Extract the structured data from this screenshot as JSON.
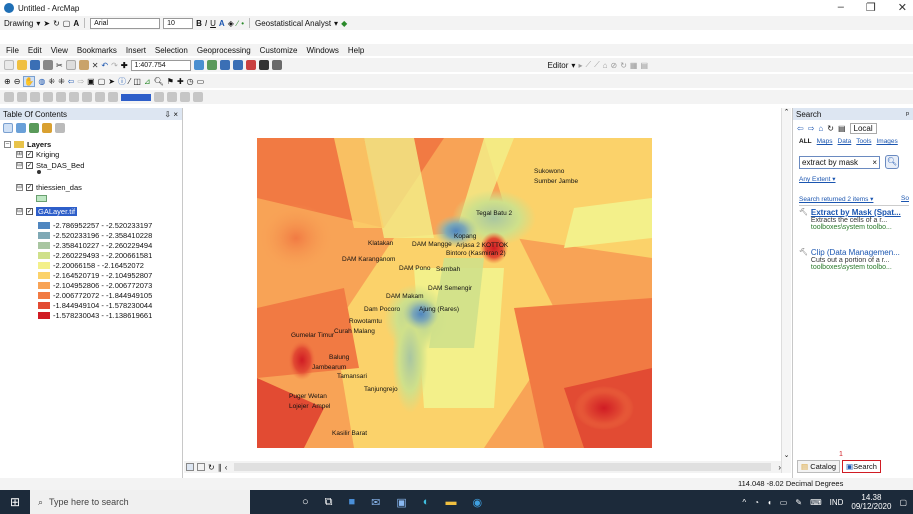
{
  "window": {
    "title": "Untitled - ArcMap"
  },
  "draw_toolbar": {
    "drawing_label": "Drawing",
    "font_name": "Arial",
    "font_size": "10",
    "geostat_label": "Geostatistical Analyst"
  },
  "menu": [
    "File",
    "Edit",
    "View",
    "Bookmarks",
    "Insert",
    "Selection",
    "Geoprocessing",
    "Customize",
    "Windows",
    "Help"
  ],
  "standard_toolbar": {
    "scale": "1:407.754",
    "editor_label": "Editor"
  },
  "toc": {
    "title": "Table Of Contents",
    "close": "× ",
    "pin": "⇩",
    "layers_root": "Layers",
    "layers": [
      {
        "label": "Kriging",
        "expander": "⊞"
      },
      {
        "label": "Sta_DAS_Bed",
        "expander": "⊟"
      },
      {
        "label": "thiessien_das",
        "expander": "⊟"
      },
      {
        "label": "GALayer.tif",
        "expander": "⊟"
      }
    ],
    "legend": [
      {
        "label": "-2.786952257 - -2.520233197",
        "color": "#4f86c0"
      },
      {
        "label": "-2.520233196 - -2.358410228",
        "color": "#7fa9b5"
      },
      {
        "label": "-2.358410227 - -2.260229494",
        "color": "#a9c6a1"
      },
      {
        "label": "-2.260229493 - -2.200661581",
        "color": "#cfe08a"
      },
      {
        "label": "-2.20066158 - -2.16452072",
        "color": "#f3f08a"
      },
      {
        "label": "-2.164520719 - -2.104952807",
        "color": "#fbd26a"
      },
      {
        "label": "-2.104952806 - -2.006772073",
        "color": "#f8a356"
      },
      {
        "label": "-2.006772072 - -1.844949105",
        "color": "#f17a43"
      },
      {
        "label": "-1.844949104 - -1.578230044",
        "color": "#e24b33"
      },
      {
        "label": "-1.578230043 - -1.138619661",
        "color": "#d01c24"
      }
    ]
  },
  "map": {
    "labels": [
      "Sukowono",
      "Sumber Jambe",
      "Tegal Batu 2",
      "Klatakan",
      "DAM Mangge",
      "Kopang",
      "Arjasa 2 KOTTOK",
      "Bintoro (Kasmiran 2)",
      "DAM Karanganom",
      "DAM Pono",
      "Sembah",
      "DAM Semengir",
      "DAM Makam",
      "Dam Pocoro",
      "Ajung (Rares)",
      "Rowotamtu",
      "Curah Malang",
      "Gumelar Timur",
      "Balung",
      "Jambearum",
      "Tamansari",
      "Tanjungrejo",
      "Puger Wetan",
      "Lojejer",
      "Ampel",
      "Kasilir Barat"
    ]
  },
  "search": {
    "title": "Search",
    "pin": "ᵖ",
    "location": "Local",
    "filters": [
      "ALL",
      "Maps",
      "Data",
      "Tools",
      "Images"
    ],
    "query": "extract by mask",
    "clear": "×",
    "extent": "Any Extent ▾",
    "returned": "Search returned 2 items ▾",
    "sort": "So",
    "results": [
      {
        "title": "Extract by Mask (Spat...",
        "desc": "Extracts the cells of a r...",
        "path": "toolboxes\\system toolbo..."
      },
      {
        "title": "Clip (Data Managemen...",
        "desc": "Cuts out a portion of a r...",
        "path": "toolboxes\\system toolbo..."
      }
    ],
    "tab_catalog": "Catalog",
    "tab_search": "Search",
    "badge": "1"
  },
  "status": {
    "coords": "114.048 -8.02 Decimal Degrees"
  },
  "taskbar": {
    "search_placeholder": "Type here to search",
    "time": "14.38",
    "date": "09/12/2020",
    "lang": "IND"
  },
  "colors": {
    "accent": "#1a55b0",
    "titlebar": "#ffffff",
    "taskbar": "#1c2a3a"
  }
}
